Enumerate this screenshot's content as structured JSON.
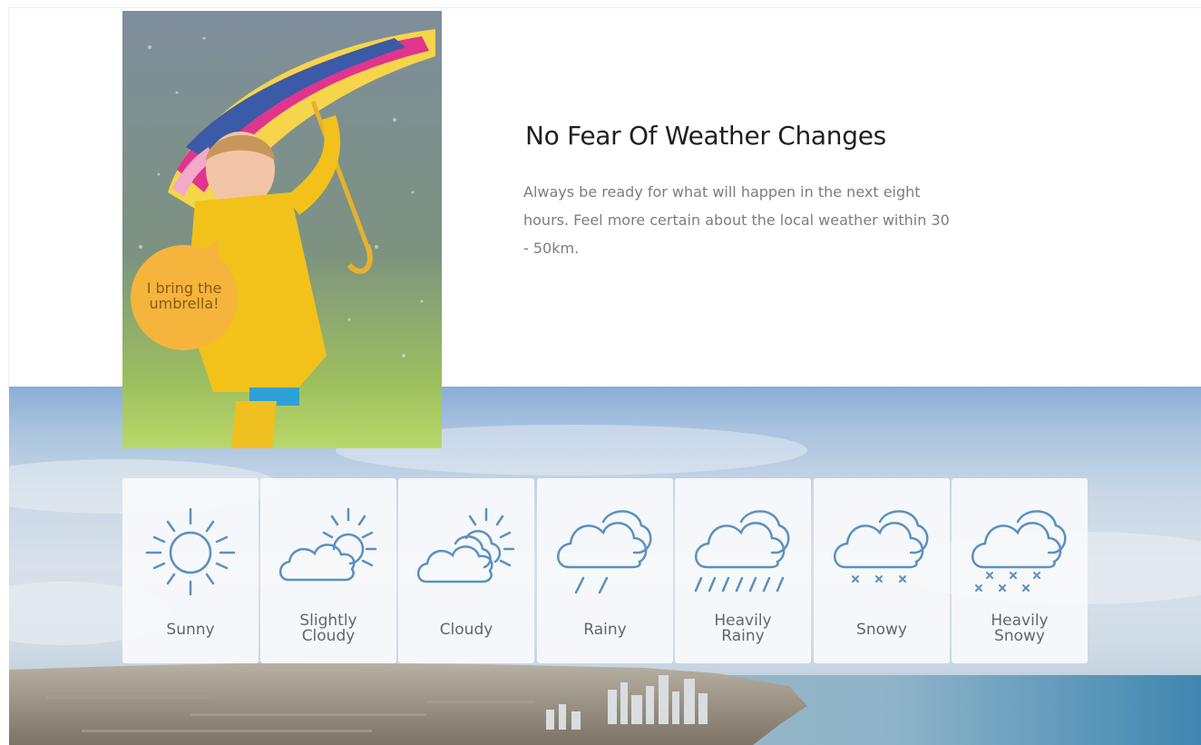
{
  "feature": {
    "title": "No Fear Of Weather Changes",
    "description": "Always be ready for what will happen in the next eight hours. Feel more certain about the local weather within 30 - 50km."
  },
  "photo": {
    "bubble_text": "I bring the\numbrella!"
  },
  "colors": {
    "icon_stroke": "#5b91bf",
    "bubble_fill": "#f5b43c",
    "card_background": "#f8f9fb",
    "title_text": "#1f1f1f",
    "body_text": "#7d7d7d"
  },
  "weather_types": [
    {
      "label": "Sunny",
      "icon": "sun-icon"
    },
    {
      "label": "Slightly\nCloudy",
      "icon": "partly-cloudy-icon"
    },
    {
      "label": "Cloudy",
      "icon": "cloudy-icon"
    },
    {
      "label": "Rainy",
      "icon": "rain-icon"
    },
    {
      "label": "Heavily\nRainy",
      "icon": "heavy-rain-icon"
    },
    {
      "label": "Snowy",
      "icon": "snow-icon"
    },
    {
      "label": "Heavily\nSnowy",
      "icon": "heavy-snow-icon"
    }
  ]
}
